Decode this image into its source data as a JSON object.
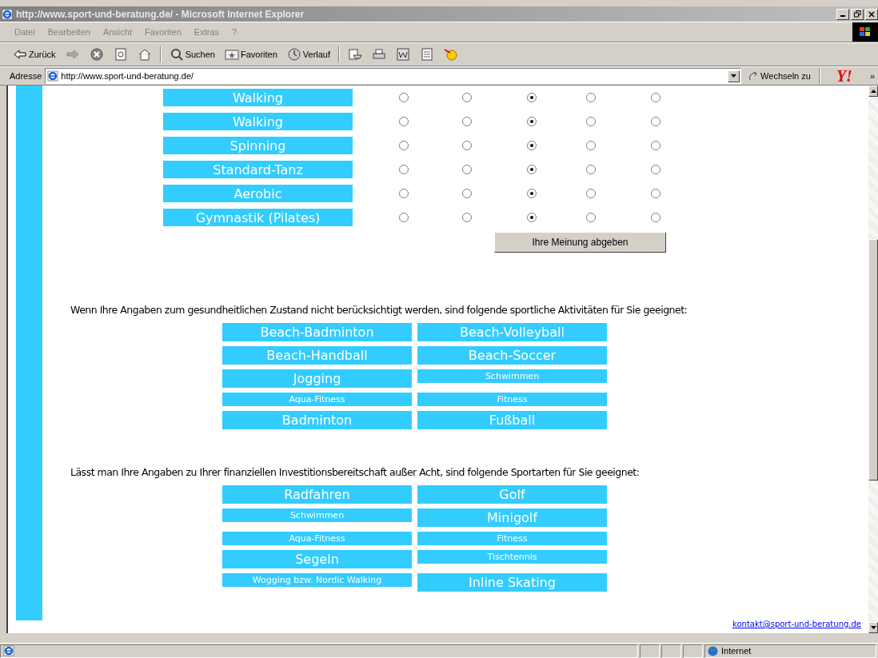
{
  "window": {
    "title": "http://www.sport-und-beratung.de/ - Microsoft Internet Explorer"
  },
  "menu": [
    "Datei",
    "Bearbeiten",
    "Ansicht",
    "Favoriten",
    "Extras",
    "?"
  ],
  "toolbar": [
    {
      "kind": "back",
      "label": "Zurück"
    },
    {
      "kind": "forward"
    },
    {
      "kind": "stop"
    },
    {
      "kind": "refresh"
    },
    {
      "kind": "home"
    },
    {
      "kind": "search",
      "label": "Suchen"
    },
    {
      "kind": "favorites",
      "label": "Favoriten"
    },
    {
      "kind": "history",
      "label": "Verlauf"
    },
    {
      "kind": "mail"
    },
    {
      "kind": "print"
    },
    {
      "kind": "edit"
    },
    {
      "kind": "discuss"
    },
    {
      "kind": "messenger"
    }
  ],
  "address": {
    "label": "Adresse",
    "value": "http://www.sport-und-beratung.de/",
    "go": "Wechseln zu",
    "logo": "Y!",
    "more": "»"
  },
  "ratings": [
    {
      "label": "Walking",
      "options": [
        {
          "selected": false
        },
        {
          "selected": false
        },
        {
          "selected": true
        },
        {
          "selected": false
        },
        {
          "selected": false
        }
      ]
    },
    {
      "label": "Walking",
      "options": [
        {
          "selected": false
        },
        {
          "selected": false
        },
        {
          "selected": true
        },
        {
          "selected": false
        },
        {
          "selected": false
        }
      ]
    },
    {
      "label": "Spinning",
      "options": [
        {
          "selected": false
        },
        {
          "selected": false
        },
        {
          "selected": true
        },
        {
          "selected": false
        },
        {
          "selected": false
        }
      ]
    },
    {
      "label": "Standard-Tanz",
      "options": [
        {
          "selected": false
        },
        {
          "selected": false
        },
        {
          "selected": true
        },
        {
          "selected": false
        },
        {
          "selected": false
        }
      ]
    },
    {
      "label": "Aerobic",
      "options": [
        {
          "selected": false
        },
        {
          "selected": false
        },
        {
          "selected": true
        },
        {
          "selected": false
        },
        {
          "selected": false
        }
      ]
    },
    {
      "label": "Gymnastik (Pilates)",
      "options": [
        {
          "selected": false
        },
        {
          "selected": false
        },
        {
          "selected": true
        },
        {
          "selected": false
        },
        {
          "selected": false
        }
      ]
    }
  ],
  "submit": "Ihre Meinung abgeben",
  "sections": [
    {
      "text": "Wenn Ihre Angaben zum gesundheitlichen Zustand nicht berücksichtigt werden, sind folgende sportliche Aktivitäten für Sie geeignet:",
      "items": [
        {
          "label": "Beach-Badminton",
          "kind": "large"
        },
        {
          "label": "Beach-Volleyball",
          "kind": "large"
        },
        {
          "label": "Beach-Handball",
          "kind": "large"
        },
        {
          "label": "Beach-Soccer",
          "kind": "large"
        },
        {
          "label": "Jogging",
          "kind": "large"
        },
        {
          "label": "Schwimmen",
          "kind": "small"
        },
        {
          "label": "Aqua-Fitness",
          "kind": "small"
        },
        {
          "label": "Fitness",
          "kind": "small"
        },
        {
          "label": "Badminton",
          "kind": "large"
        },
        {
          "label": "Fußball",
          "kind": "large"
        }
      ]
    },
    {
      "text": "Lässt man Ihre Angaben zu Ihrer finanziellen Investitionsbereitschaft außer Acht, sind folgende Sportarten für Sie geeignet:",
      "items": [
        {
          "label": "Radfahren",
          "kind": "large"
        },
        {
          "label": "Golf",
          "kind": "large"
        },
        {
          "label": "Schwimmen",
          "kind": "small"
        },
        {
          "label": "Minigolf",
          "kind": "large"
        },
        {
          "label": "Aqua-Fitness",
          "kind": "small"
        },
        {
          "label": "Fitness",
          "kind": "small"
        },
        {
          "label": "Segeln",
          "kind": "large"
        },
        {
          "label": "Tischtennis",
          "kind": "small"
        },
        {
          "label": "Wogging bzw. Nordic Walking",
          "kind": "small"
        },
        {
          "label": "Inline Skating",
          "kind": "large"
        }
      ]
    }
  ],
  "contact": "kontakt@sport-und-beratung.de",
  "status": {
    "zone": "Internet"
  }
}
